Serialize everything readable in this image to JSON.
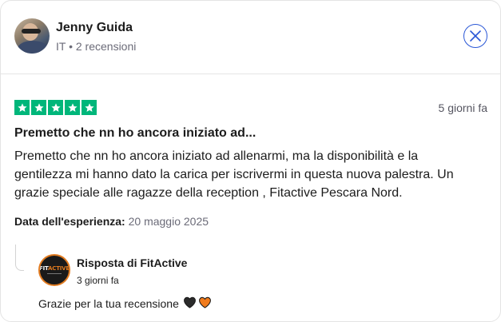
{
  "reviewer": {
    "name": "Jenny Guida",
    "meta": "IT • 2 recensioni"
  },
  "review": {
    "rating": 5,
    "star_color": "#00b67a",
    "date": "5 giorni fa",
    "title": "Premetto che nn ho ancora iniziato ad...",
    "body": "Premetto che nn ho ancora iniziato ad allenarmi, ma la disponibilità e la gentilezza mi hanno dato la carica per iscrivermi in questa nuova palestra. Un grazie speciale alle ragazze della reception , Fitactive Pescara Nord.",
    "experience_label": "Data dell'esperienza:",
    "experience_date": "20 maggio 2025"
  },
  "reply": {
    "logo_text_a": "FIT",
    "logo_text_b": "ACTIVE",
    "title": "Risposta di FitActive",
    "date": "3 giorni fa",
    "body": "Grazie per la tua recensione",
    "heart_colors": [
      "#2b2b2b",
      "#f07b1d"
    ]
  },
  "icons": {
    "close": "close-icon",
    "star": "star-icon",
    "heart": "heart-icon"
  }
}
